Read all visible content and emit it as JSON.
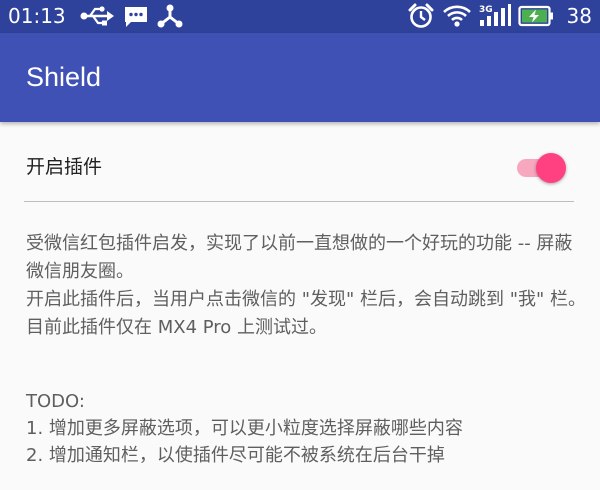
{
  "status_bar": {
    "time": "01:13",
    "battery_percent": "38",
    "icons": [
      "usb-icon",
      "chat-icon",
      "sync-icon",
      "alarm-icon",
      "wifi-icon",
      "3g-signal-icon",
      "battery-charging-icon"
    ]
  },
  "app_bar": {
    "title": "Shield",
    "color": "#3f51b5"
  },
  "settings": {
    "toggle_label": "开启插件",
    "toggle_on": true,
    "accent_color": "#ff4081"
  },
  "description": [
    "受微信红包插件启发，实现了以前一直想做的一个好玩的功能 -- 屏蔽微信朋友圈。",
    "开启此插件后，当用户点击微信的 \"发现\" 栏后，会自动跳到 \"我\" 栏。",
    "目前此插件仅在 MX4 Pro 上测试过。"
  ],
  "todo": {
    "heading": "TODO:",
    "items": [
      "1. 增加更多屏蔽选项，可以更小粒度选择屏蔽哪些内容",
      "2. 增加通知栏，以使插件尽可能不被系统在后台干掉"
    ]
  }
}
